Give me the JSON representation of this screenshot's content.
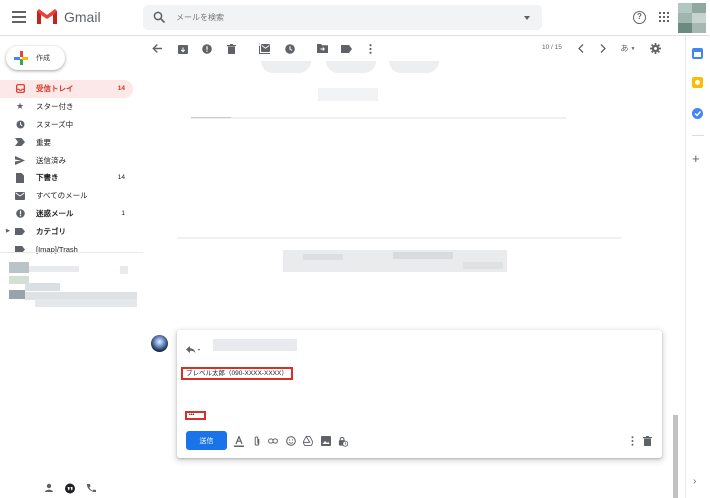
{
  "app": {
    "name": "Gmail"
  },
  "search": {
    "placeholder": "メールを検索"
  },
  "compose_label": "作成",
  "nav": [
    {
      "label": "受信トレイ",
      "count": "14",
      "icon": "inbox-icon",
      "active": true,
      "bold": true
    },
    {
      "label": "スター付き",
      "count": "",
      "icon": "star-icon"
    },
    {
      "label": "スヌーズ中",
      "count": "",
      "icon": "clock-icon"
    },
    {
      "label": "重要",
      "count": "",
      "icon": "important-icon"
    },
    {
      "label": "送信済み",
      "count": "",
      "icon": "send-icon"
    },
    {
      "label": "下書き",
      "count": "14",
      "icon": "draft-icon",
      "bold": true
    },
    {
      "label": "すべてのメール",
      "count": "",
      "icon": "mail-icon"
    },
    {
      "label": "迷惑メール",
      "count": "1",
      "icon": "spam-icon",
      "bold": true
    },
    {
      "label": "カテゴリ",
      "count": "",
      "icon": "label-icon",
      "bold": true
    },
    {
      "label": "[Imap]/Trash",
      "count": "",
      "icon": "label-icon"
    }
  ],
  "pager": {
    "text": "10 / 15"
  },
  "input_tool": {
    "label": "あ"
  },
  "reply": {
    "signature": "ブレベル太郎（090-XXXX-XXXX）",
    "dots": "•••",
    "send_label": "送信"
  },
  "colors": {
    "accent": "#d93025",
    "primary": "#1a73e8",
    "active_bg": "#fce8e6"
  }
}
